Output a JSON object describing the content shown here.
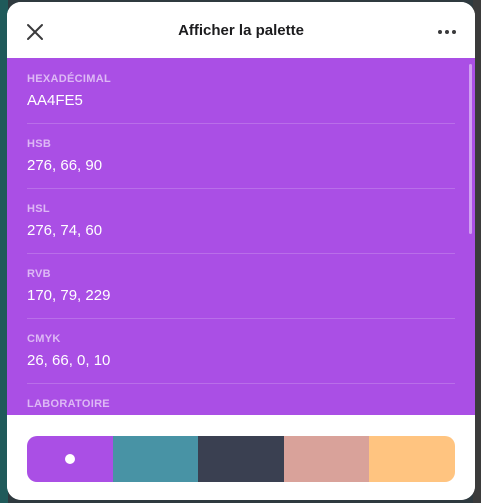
{
  "header": {
    "title": "Afficher la palette",
    "close_icon": "close-icon",
    "more_icon": "more-icon"
  },
  "selected_color": "#AA4FE5",
  "details": [
    {
      "label": "HEXADÉCIMAL",
      "value": "AA4FE5"
    },
    {
      "label": "HSB",
      "value": "276, 66, 90"
    },
    {
      "label": "HSL",
      "value": "276, 74, 60"
    },
    {
      "label": "RVB",
      "value": "170, 79, 229"
    },
    {
      "label": "CMYK",
      "value": "26, 66, 0, 10"
    },
    {
      "label": "LABORATOIRE",
      "value": ""
    }
  ],
  "palette": [
    {
      "color": "#AA4FE5",
      "selected": true
    },
    {
      "color": "#4893A5",
      "selected": false
    },
    {
      "color": "#3A4051",
      "selected": false
    },
    {
      "color": "#D9A29A",
      "selected": false
    },
    {
      "color": "#FFC480",
      "selected": false
    }
  ]
}
